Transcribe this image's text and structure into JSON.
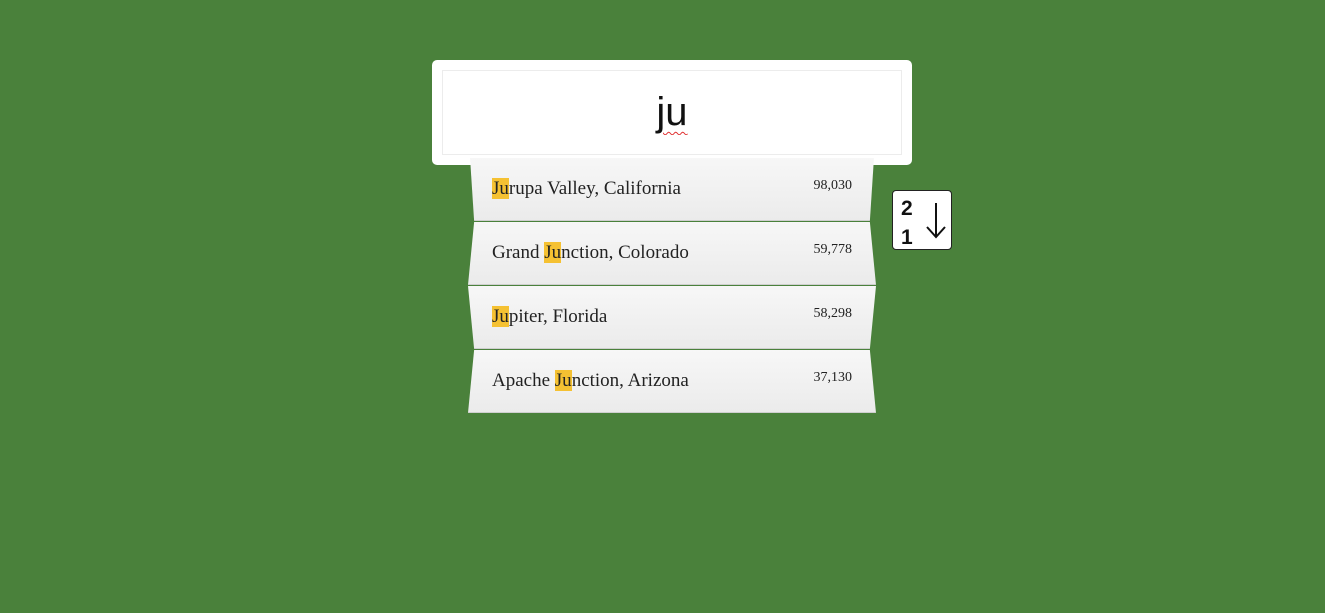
{
  "search": {
    "value": "ju",
    "placeholder": ""
  },
  "results": [
    {
      "pre": "",
      "match": "Ju",
      "post": "rupa Valley, California",
      "population": "98,030"
    },
    {
      "pre": "Grand ",
      "match": "Ju",
      "post": "nction, Colorado",
      "population": "59,778"
    },
    {
      "pre": "",
      "match": "Ju",
      "post": "piter, Florida",
      "population": "58,298"
    },
    {
      "pre": "Apache ",
      "match": "Ju",
      "post": "nction, Arizona",
      "population": "37,130"
    }
  ],
  "sort_button": {
    "top_digit": "2",
    "bottom_digit": "1",
    "icon": "arrow-down-icon"
  },
  "colors": {
    "background": "#4a813b",
    "highlight": "#f5c132"
  }
}
